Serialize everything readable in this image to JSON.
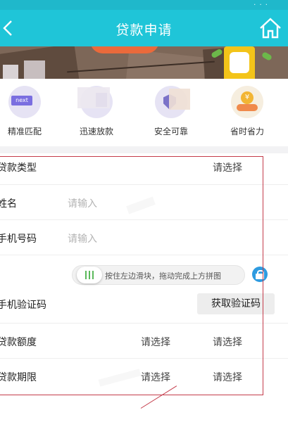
{
  "colors": {
    "nav": "#1fc5d8",
    "accent_green": "#5bb95b",
    "lock_blue": "#2e9be0",
    "annotation_red": "#c43b4a"
  },
  "status_bar": {
    "dots": "· · ·"
  },
  "navbar": {
    "title": "贷款申请",
    "back_icon": "chevron-left-icon",
    "home_icon": "home-icon"
  },
  "features": [
    {
      "label": "精准匹配",
      "icon": "next-icon",
      "icon_text": "next"
    },
    {
      "label": "迅速放款",
      "icon": "speed-icon"
    },
    {
      "label": "安全可靠",
      "icon": "shield-icon"
    },
    {
      "label": "省时省力",
      "icon": "coin-hand-icon",
      "icon_text": "¥"
    }
  ],
  "form": {
    "loan_type": {
      "label": "贷款类型",
      "value": "请选择"
    },
    "name": {
      "label": "姓名",
      "placeholder": "请输入"
    },
    "phone": {
      "label": "手机号码",
      "placeholder": "请输入"
    },
    "captcha": {
      "slider_text": "按住左边滑块，拖动完成上方拼图",
      "slider_progress": 0
    },
    "sms_code": {
      "label": "手机验证码",
      "button": "获取验证码"
    },
    "amount": {
      "label": "贷款额度",
      "value1": "请选择",
      "value2": "请选择"
    },
    "term": {
      "label": "贷款期限",
      "value1": "请选择",
      "value2": "请选择"
    }
  }
}
